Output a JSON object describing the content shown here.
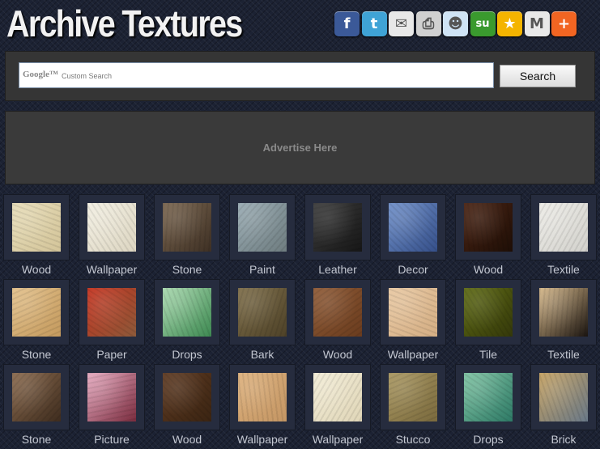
{
  "header": {
    "site_title": "Archive Textures",
    "share_icons": [
      {
        "name": "facebook-icon",
        "glyph": "f",
        "color": "#3b5998"
      },
      {
        "name": "twitter-icon",
        "glyph": "t",
        "color": "#3fa3d6"
      },
      {
        "name": "email-icon",
        "glyph": "✉",
        "color": "#e8e8e8"
      },
      {
        "name": "print-icon",
        "glyph": "⎙",
        "color": "#d0d0d0"
      },
      {
        "name": "reddit-icon",
        "glyph": "☻",
        "color": "#cfe3f5"
      },
      {
        "name": "stumbleupon-icon",
        "glyph": "su",
        "color": "#3a9a2e"
      },
      {
        "name": "favorites-icon",
        "glyph": "★",
        "color": "#f4b400"
      },
      {
        "name": "gmail-icon",
        "glyph": "M",
        "color": "#e8e8e8"
      },
      {
        "name": "more-share-icon",
        "glyph": "+",
        "color": "#f26522"
      }
    ]
  },
  "search": {
    "logo_text": "Google™",
    "placeholder": "Custom Search",
    "button_label": "Search"
  },
  "ad": {
    "text": "Advertise Here"
  },
  "textures": [
    {
      "label": "Wood",
      "colors": [
        "#e6dcb8",
        "#d4c59a"
      ]
    },
    {
      "label": "Wallpaper",
      "colors": [
        "#f2efe2",
        "#ddd6c2"
      ]
    },
    {
      "label": "Stone",
      "colors": [
        "#7a6650",
        "#3e3024"
      ]
    },
    {
      "label": "Paint",
      "colors": [
        "#98aab2",
        "#6f7d80"
      ]
    },
    {
      "label": "Leather",
      "colors": [
        "#3c3c3c",
        "#161616"
      ]
    },
    {
      "label": "Decor",
      "colors": [
        "#6f8fc8",
        "#36508a"
      ]
    },
    {
      "label": "Wood",
      "colors": [
        "#4a2414",
        "#1e0e06"
      ]
    },
    {
      "label": "Textile",
      "colors": [
        "#ecebe6",
        "#d3d2cd"
      ]
    },
    {
      "label": "Stone",
      "colors": [
        "#e2c08a",
        "#c49a5e"
      ]
    },
    {
      "label": "Paper",
      "colors": [
        "#c4321e",
        "#8c5a3a"
      ]
    },
    {
      "label": "Drops",
      "colors": [
        "#a8d8ae",
        "#3e8a52"
      ]
    },
    {
      "label": "Bark",
      "colors": [
        "#7e6e4a",
        "#4e4228"
      ]
    },
    {
      "label": "Wood",
      "colors": [
        "#8e5a36",
        "#6a3c1e"
      ]
    },
    {
      "label": "Wallpaper",
      "colors": [
        "#e8c8a2",
        "#d4ae84"
      ]
    },
    {
      "label": "Tile",
      "colors": [
        "#5e6a14",
        "#34380a"
      ]
    },
    {
      "label": "Textile",
      "colors": [
        "#d6b88a",
        "#1a1410"
      ]
    },
    {
      "label": "Stone",
      "colors": [
        "#8a6a4e",
        "#3e2c1e"
      ]
    },
    {
      "label": "Picture",
      "colors": [
        "#e6aac0",
        "#7a2c3e"
      ]
    },
    {
      "label": "Wood",
      "colors": [
        "#5e3a22",
        "#3a2412"
      ]
    },
    {
      "label": "Wallpaper",
      "colors": [
        "#dcb07c",
        "#c49664"
      ]
    },
    {
      "label": "Wallpaper",
      "colors": [
        "#f2ecd6",
        "#e0d6b8"
      ]
    },
    {
      "label": "Stucco",
      "colors": [
        "#a89660",
        "#7a6a3e"
      ]
    },
    {
      "label": "Drops",
      "colors": [
        "#7ec2a2",
        "#2e7a66"
      ]
    },
    {
      "label": "Brick",
      "colors": [
        "#c4a060",
        "#6a7a8a"
      ]
    }
  ]
}
